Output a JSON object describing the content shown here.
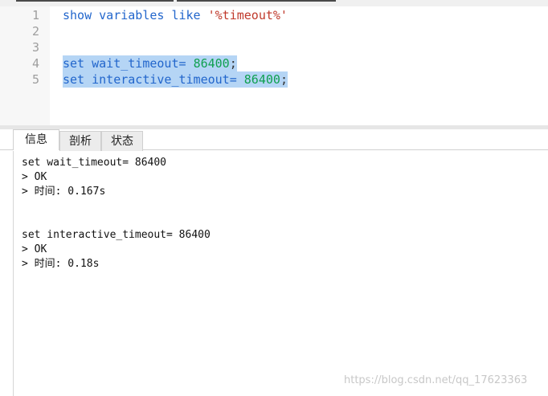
{
  "editor": {
    "lines": [
      {
        "num": "1",
        "parts": [
          {
            "t": "show variables like ",
            "c": "kw"
          },
          {
            "t": "'%timeout%'",
            "c": "str"
          }
        ]
      },
      {
        "num": "2",
        "parts": []
      },
      {
        "num": "3",
        "parts": []
      },
      {
        "num": "4",
        "parts": [
          {
            "t": "set wait_timeout= ",
            "c": "kw"
          },
          {
            "t": "86400",
            "c": "num"
          },
          {
            "t": ";",
            "c": "dark"
          }
        ]
      },
      {
        "num": "5",
        "parts": [
          {
            "t": "set interactive_timeout= ",
            "c": "kw"
          },
          {
            "t": "86400",
            "c": "num"
          },
          {
            "t": ";",
            "c": "dark"
          }
        ]
      }
    ],
    "line_numbers": [
      "1",
      "2",
      "3",
      "4",
      "5"
    ],
    "line1_a": "show variables like ",
    "line1_b": "'%timeout%'",
    "line4_a": "set wait_timeout= ",
    "line4_b": "86400",
    "line4_c": ";",
    "line5_a": "set interactive_timeout= ",
    "line5_b": "86400",
    "line5_c": ";"
  },
  "tabs": {
    "info": "信息",
    "profile": "剖析",
    "status": "状态"
  },
  "output": {
    "l1": "set wait_timeout= 86400",
    "l2": "> OK",
    "l3": "> 时间: 0.167s",
    "l4": "set interactive_timeout= 86400",
    "l5": "> OK",
    "l6": "> 时间: 0.18s"
  },
  "watermark": "https://blog.csdn.net/qq_17623363"
}
